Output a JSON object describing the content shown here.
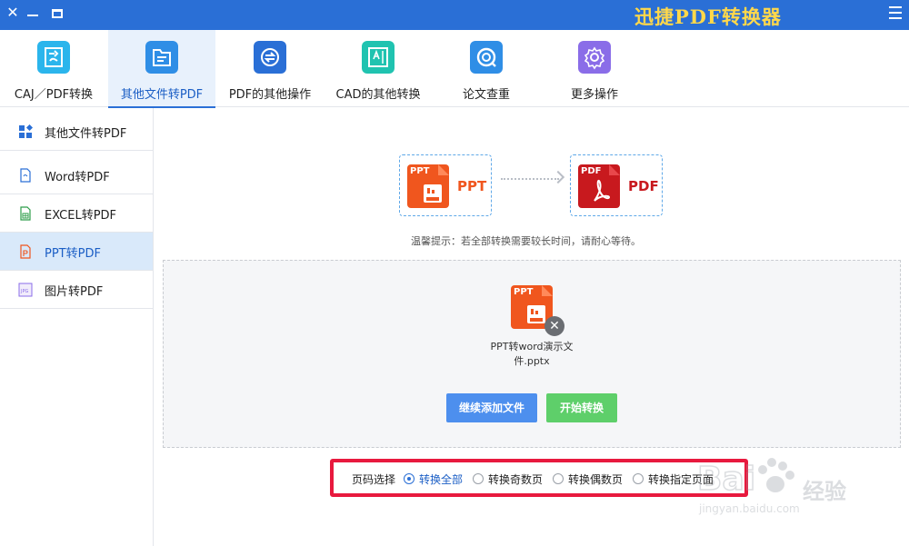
{
  "window": {
    "title": "迅捷PDF转换器",
    "close_glyph": "✕"
  },
  "toolbar": {
    "items": [
      {
        "label": "CAJ／PDF转换",
        "icon": "caj-pdf-convert-icon",
        "color": "#2bb5ec"
      },
      {
        "label": "其他文件转PDF",
        "icon": "other-to-pdf-icon",
        "color": "#2f8ee6"
      },
      {
        "label": "PDF的其他操作",
        "icon": "pdf-operations-icon",
        "color": "#2a6fd6"
      },
      {
        "label": "CAD的其他转换",
        "icon": "cad-convert-icon",
        "color": "#20c3b0"
      },
      {
        "label": "论文查重",
        "icon": "paper-check-icon",
        "color": "#2f8ee6"
      },
      {
        "label": "更多操作",
        "icon": "gear-icon",
        "color": "#8a6de8"
      }
    ],
    "active_index": 1
  },
  "sidebar": {
    "items": [
      {
        "label": "其他文件转PDF",
        "icon": "grid-icon"
      },
      {
        "label": "Word转PDF",
        "icon": "word-file-icon"
      },
      {
        "label": "EXCEL转PDF",
        "icon": "excel-file-icon"
      },
      {
        "label": "PPT转PDF",
        "icon": "ppt-file-icon"
      },
      {
        "label": "图片转PDF",
        "icon": "image-file-icon"
      }
    ],
    "active_index": 3
  },
  "conversion": {
    "from_label": "PPT",
    "from_icon_text": "PPT",
    "to_label": "PDF",
    "to_icon_text": "PDF",
    "from_color": "#f0561e",
    "to_color": "#c8191e"
  },
  "hint": "温馨提示：若全部转换需要较长时间，请耐心等待。",
  "file": {
    "icon_text": "PPT",
    "name": "PPT转word演示文件.pptx"
  },
  "buttons": {
    "add_files": "继续添加文件",
    "start": "开始转换"
  },
  "page_select": {
    "label": "页码选择",
    "options": [
      "转换全部",
      "转换奇数页",
      "转换偶数页",
      "转换指定页面"
    ],
    "selected_index": 0
  },
  "watermark": {
    "brand": "经验",
    "url": "jingyan.baidu.com"
  },
  "colors": {
    "accent": "#2a6fd6",
    "title_text": "#ffd84a",
    "highlight_border": "#e8193e"
  }
}
